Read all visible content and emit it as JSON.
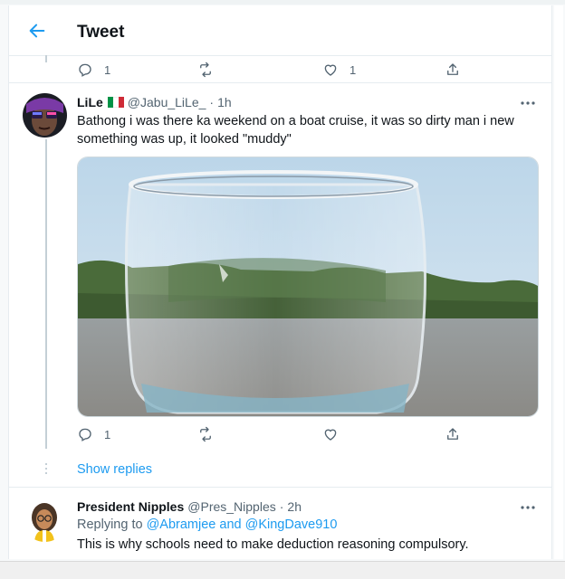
{
  "header": {
    "title": "Tweet",
    "back_icon": "arrow-left-icon"
  },
  "colors": {
    "accent": "#1d9bf0",
    "muted": "#536471",
    "flag_green": "#009246",
    "flag_red": "#ce2b37"
  },
  "prev_tweet": {
    "actions": {
      "reply_count": "1",
      "retweet_count": "",
      "like_count": "1"
    }
  },
  "reply_tweet": {
    "name": "LiLe",
    "flag": "Italy flag",
    "handle": "@Jabu_LiLe_",
    "separator": "·",
    "time": "1h",
    "text_line1": "Bathong i was there ka weekend on a boat cruise, it was so dirty man i new",
    "text_line2": "something was up, it looked \"muddy\"",
    "media_description": "glass-over-river-photo",
    "actions": {
      "reply_count": "1",
      "retweet_count": "",
      "like_count": ""
    }
  },
  "show_replies_label": "Show replies",
  "next_tweet": {
    "name": "President Nipples",
    "handle": "@Pres_Nipples",
    "separator": "·",
    "time": "2h",
    "replying_prefix": "Replying to",
    "replying_user1": "@Abramjee",
    "replying_and": "and",
    "replying_user2": "@KingDave910",
    "text": "This is why schools need to make deduction reasoning compulsory."
  }
}
